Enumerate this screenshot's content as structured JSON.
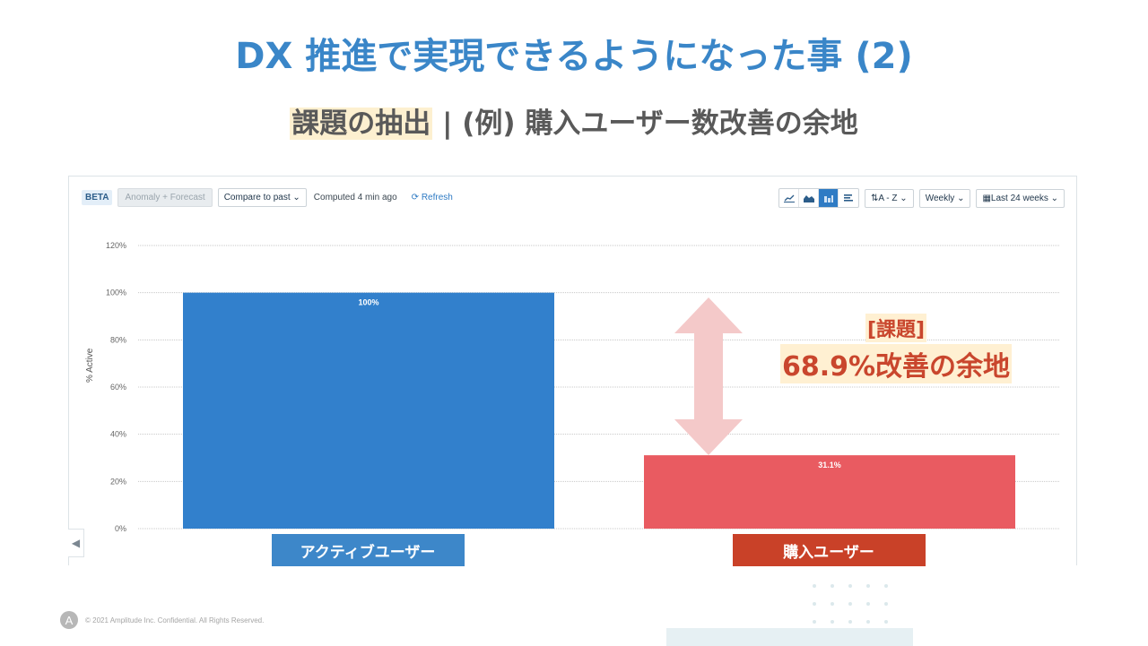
{
  "slide": {
    "title": "DX 推進で実現できるようになった事 (2)",
    "subtitle_highlight": "課題の抽出",
    "subtitle_rest": " | (例) 購入ユーザー数改善の余地"
  },
  "toolbar": {
    "beta_label": "BETA",
    "anomaly_label": "Anomaly + Forecast",
    "compare_label": "Compare to past ⌄",
    "computed_label": "Computed 4 min ago",
    "refresh_label": "Refresh",
    "refresh_icon": "refresh-icon",
    "viz_buttons": [
      {
        "icon": "line-chart-icon",
        "active": false
      },
      {
        "icon": "area-chart-icon",
        "active": false
      },
      {
        "icon": "bar-chart-icon",
        "active": true
      },
      {
        "icon": "horizontal-bar-icon",
        "active": false
      }
    ],
    "sort_label": "A - Z ⌄",
    "interval_label": "Weekly ⌄",
    "range_label": "Last 24 weeks ⌄"
  },
  "annotation": {
    "line1": "[課題]",
    "line2": "68.9%改善の余地",
    "color": "#c9462d",
    "highlight": "#fff0d2",
    "arrow_color": "#f4c9c9"
  },
  "chart_data": {
    "type": "bar",
    "title": "",
    "xlabel": "",
    "ylabel": "% Active",
    "ylim": [
      0,
      120
    ],
    "yticks": [
      "0%",
      "20%",
      "40%",
      "60%",
      "80%",
      "100%",
      "120%"
    ],
    "ytick_values": [
      0,
      20,
      40,
      60,
      80,
      100,
      120
    ],
    "grid": true,
    "categories": [
      "アクティブユーザー",
      "購入ユーザー"
    ],
    "values": [
      100,
      31.1
    ],
    "value_labels": [
      "100%",
      "31.1%"
    ],
    "bar_colors": [
      "#3280cc",
      "#e95b61"
    ],
    "category_label_colors": [
      "#3d87c9",
      "#c94128"
    ]
  },
  "footer": {
    "logo_icon": "amplitude-logo-icon",
    "text": "© 2021 Amplitude Inc.  Confidential.  All Rights Reserved."
  }
}
